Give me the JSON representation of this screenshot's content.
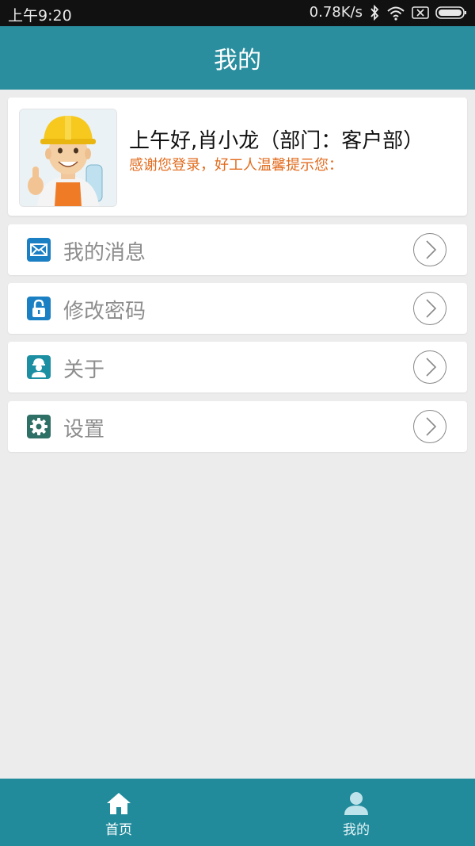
{
  "status_bar": {
    "time": "上午9:20",
    "speed": "0.78K/s",
    "icons": [
      "bluetooth-icon",
      "wifi-icon",
      "sim-icon",
      "battery-icon"
    ]
  },
  "header": {
    "title": "我的"
  },
  "profile": {
    "avatar": "worker-avatar",
    "greeting": "上午好,肖小龙（部门：客户部）",
    "tip": "感谢您登录，好工人温馨提示您："
  },
  "menu": [
    {
      "label": "我的消息",
      "icon": "mail-icon",
      "color": "#1b7fc4"
    },
    {
      "label": "修改密码",
      "icon": "lock-icon",
      "color": "#1b7fc4"
    },
    {
      "label": "关于",
      "icon": "worker-icon",
      "color": "#1d8fa3"
    },
    {
      "label": "设置",
      "icon": "gear-icon",
      "color": "#2e6f66"
    }
  ],
  "tabs": [
    {
      "label": "首页",
      "icon": "home-icon"
    },
    {
      "label": "我的",
      "icon": "user-icon"
    }
  ],
  "colors": {
    "primary": "#2a8e9f",
    "bottom_bar": "#218b9c",
    "tip_text": "#e26b1d",
    "background": "#ececec"
  }
}
